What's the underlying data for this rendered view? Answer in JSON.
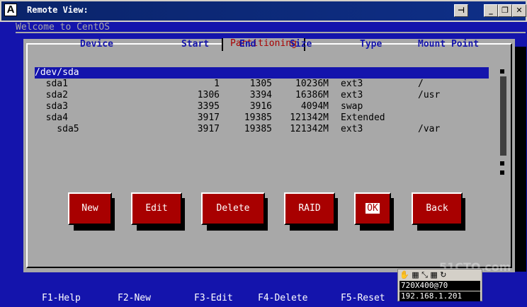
{
  "window": {
    "title": "Remote View:",
    "app_icon_letter": "A",
    "pin_symbol": "⊣",
    "minimize_symbol": "_",
    "restore_symbol": "❐",
    "close_symbol": "✕"
  },
  "welcome": "Welcome to CentOS",
  "dialog": {
    "title": "Partitioning",
    "columns": [
      "Device",
      "Start",
      "End",
      "Size",
      "Type",
      "Mount Point"
    ],
    "rows": [
      {
        "device": "/dev/sda",
        "start": "",
        "end": "",
        "size": "",
        "type": "",
        "mount": "",
        "selected": true
      },
      {
        "device": "  sda1",
        "start": "1",
        "end": "1305",
        "size": "10236M",
        "type": "ext3",
        "mount": "/"
      },
      {
        "device": "  sda2",
        "start": "1306",
        "end": "3394",
        "size": "16386M",
        "type": "ext3",
        "mount": "/usr"
      },
      {
        "device": "  sda3",
        "start": "3395",
        "end": "3916",
        "size": "4094M",
        "type": "swap",
        "mount": ""
      },
      {
        "device": "  sda4",
        "start": "3917",
        "end": "19385",
        "size": "121342M",
        "type": "Extended",
        "mount": ""
      },
      {
        "device": "    sda5",
        "start": "3917",
        "end": "19385",
        "size": "121342M",
        "type": "ext3",
        "mount": "/var"
      }
    ],
    "buttons": [
      "New",
      "Edit",
      "Delete",
      "RAID",
      "OK",
      "Back"
    ]
  },
  "hints": [
    "F1-Help",
    "F2-New",
    "F3-Edit",
    "F4-Delete",
    "F5-Reset"
  ],
  "remote_toolbar": {
    "icons": "✋ ▦ ⤡ ▦ ↻",
    "resolution": "720X400@70",
    "ip": "192.168.1.201"
  },
  "watermark": "51CTO.com",
  "colors": {
    "background": "#1414ac",
    "dialog": "#a8a8a8",
    "button": "#a80000",
    "header_text": "#1414ac",
    "title_text": "#a80000"
  }
}
